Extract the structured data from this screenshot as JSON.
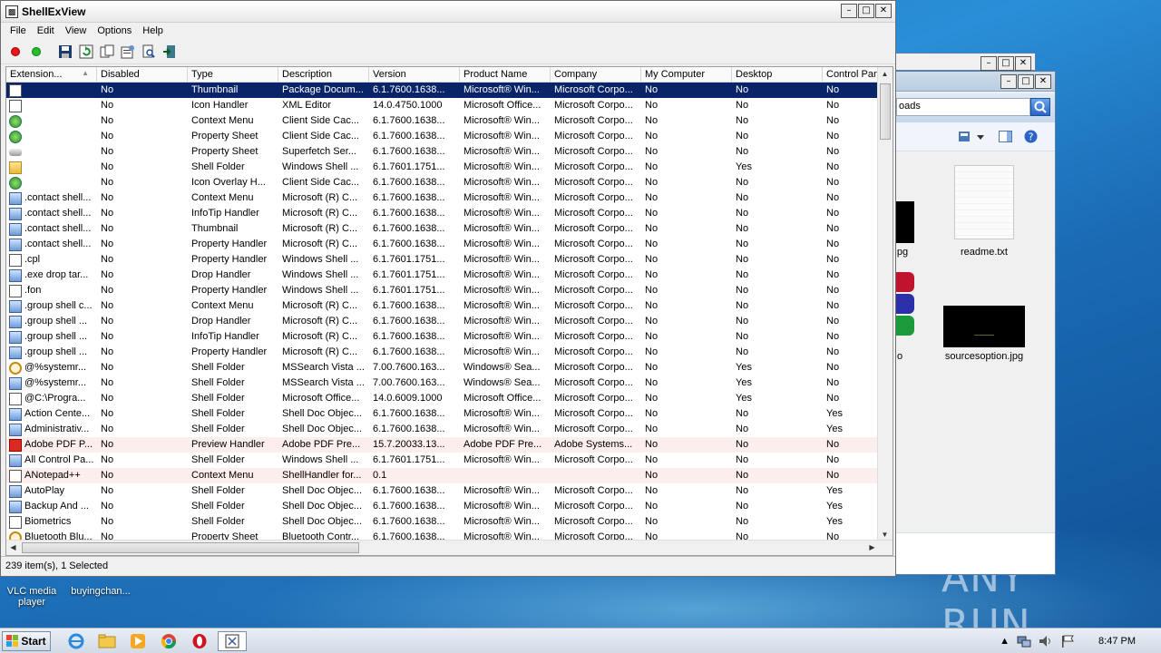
{
  "window": {
    "title": "ShellExView",
    "min": "–",
    "max": "□",
    "close": "✕"
  },
  "menu": [
    "File",
    "Edit",
    "View",
    "Options",
    "Help"
  ],
  "toolbar": [
    "red-dot-icon",
    "green-dot-icon",
    "save-icon",
    "refresh-icon",
    "copy-icon",
    "properties-icon",
    "find-icon",
    "exit-icon"
  ],
  "columns": [
    "Extension...",
    "Disabled",
    "Type",
    "Description",
    "Version",
    "Product Name",
    "Company",
    "My Computer",
    "Desktop",
    "Control Panel"
  ],
  "rows": [
    {
      "icon": "doc",
      "name": "",
      "disabled": "No",
      "type": "Thumbnail",
      "desc": "Package Docum...",
      "ver": "6.1.7600.1638...",
      "product": "Microsoft® Win...",
      "company": "Microsoft Corpo...",
      "mycomp": "No",
      "desktop": "No",
      "cp": "No",
      "selected": true
    },
    {
      "icon": "doc",
      "name": "",
      "disabled": "No",
      "type": "Icon Handler",
      "desc": "XML Editor",
      "ver": "14.0.4750.1000",
      "product": "Microsoft Office...",
      "company": "Microsoft Corpo...",
      "mycomp": "No",
      "desktop": "No",
      "cp": "No"
    },
    {
      "icon": "green",
      "name": "",
      "disabled": "No",
      "type": "Context Menu",
      "desc": "Client Side Cac...",
      "ver": "6.1.7600.1638...",
      "product": "Microsoft® Win...",
      "company": "Microsoft Corpo...",
      "mycomp": "No",
      "desktop": "No",
      "cp": "No"
    },
    {
      "icon": "green",
      "name": "",
      "disabled": "No",
      "type": "Property Sheet",
      "desc": "Client Side Cac...",
      "ver": "6.1.7600.1638...",
      "product": "Microsoft® Win...",
      "company": "Microsoft Corpo...",
      "mycomp": "No",
      "desktop": "No",
      "cp": "No"
    },
    {
      "icon": "drive",
      "name": "",
      "disabled": "No",
      "type": "Property Sheet",
      "desc": "Superfetch Ser...",
      "ver": "6.1.7600.1638...",
      "product": "Microsoft® Win...",
      "company": "Microsoft Corpo...",
      "mycomp": "No",
      "desktop": "No",
      "cp": "No"
    },
    {
      "icon": "folder",
      "name": "",
      "disabled": "No",
      "type": "Shell Folder",
      "desc": "Windows Shell ...",
      "ver": "6.1.7601.1751...",
      "product": "Microsoft® Win...",
      "company": "Microsoft Corpo...",
      "mycomp": "No",
      "desktop": "Yes",
      "cp": "No"
    },
    {
      "icon": "green",
      "name": "",
      "disabled": "No",
      "type": "Icon Overlay H...",
      "desc": "Client Side Cac...",
      "ver": "6.1.7600.1638...",
      "product": "Microsoft® Win...",
      "company": "Microsoft Corpo...",
      "mycomp": "No",
      "desktop": "No",
      "cp": "No"
    },
    {
      "icon": "blue",
      "name": ".contact shell...",
      "disabled": "No",
      "type": "Context Menu",
      "desc": "Microsoft (R) C...",
      "ver": "6.1.7600.1638...",
      "product": "Microsoft® Win...",
      "company": "Microsoft Corpo...",
      "mycomp": "No",
      "desktop": "No",
      "cp": "No"
    },
    {
      "icon": "blue",
      "name": ".contact shell...",
      "disabled": "No",
      "type": "InfoTip Handler",
      "desc": "Microsoft (R) C...",
      "ver": "6.1.7600.1638...",
      "product": "Microsoft® Win...",
      "company": "Microsoft Corpo...",
      "mycomp": "No",
      "desktop": "No",
      "cp": "No"
    },
    {
      "icon": "blue",
      "name": ".contact shell...",
      "disabled": "No",
      "type": "Thumbnail",
      "desc": "Microsoft (R) C...",
      "ver": "6.1.7600.1638...",
      "product": "Microsoft® Win...",
      "company": "Microsoft Corpo...",
      "mycomp": "No",
      "desktop": "No",
      "cp": "No"
    },
    {
      "icon": "blue",
      "name": ".contact shell...",
      "disabled": "No",
      "type": "Property Handler",
      "desc": "Microsoft (R) C...",
      "ver": "6.1.7600.1638...",
      "product": "Microsoft® Win...",
      "company": "Microsoft Corpo...",
      "mycomp": "No",
      "desktop": "No",
      "cp": "No"
    },
    {
      "icon": "doc",
      "name": ".cpl",
      "disabled": "No",
      "type": "Property Handler",
      "desc": "Windows Shell ...",
      "ver": "6.1.7601.1751...",
      "product": "Microsoft® Win...",
      "company": "Microsoft Corpo...",
      "mycomp": "No",
      "desktop": "No",
      "cp": "No"
    },
    {
      "icon": "blue",
      "name": ".exe drop tar...",
      "disabled": "No",
      "type": "Drop Handler",
      "desc": "Windows Shell ...",
      "ver": "6.1.7601.1751...",
      "product": "Microsoft® Win...",
      "company": "Microsoft Corpo...",
      "mycomp": "No",
      "desktop": "No",
      "cp": "No"
    },
    {
      "icon": "doc",
      "name": ".fon",
      "disabled": "No",
      "type": "Property Handler",
      "desc": "Windows Shell ...",
      "ver": "6.1.7601.1751...",
      "product": "Microsoft® Win...",
      "company": "Microsoft Corpo...",
      "mycomp": "No",
      "desktop": "No",
      "cp": "No"
    },
    {
      "icon": "blue",
      "name": ".group shell c...",
      "disabled": "No",
      "type": "Context Menu",
      "desc": "Microsoft (R) C...",
      "ver": "6.1.7600.1638...",
      "product": "Microsoft® Win...",
      "company": "Microsoft Corpo...",
      "mycomp": "No",
      "desktop": "No",
      "cp": "No"
    },
    {
      "icon": "blue",
      "name": ".group shell ...",
      "disabled": "No",
      "type": "Drop Handler",
      "desc": "Microsoft (R) C...",
      "ver": "6.1.7600.1638...",
      "product": "Microsoft® Win...",
      "company": "Microsoft Corpo...",
      "mycomp": "No",
      "desktop": "No",
      "cp": "No"
    },
    {
      "icon": "blue",
      "name": ".group shell ...",
      "disabled": "No",
      "type": "InfoTip Handler",
      "desc": "Microsoft (R) C...",
      "ver": "6.1.7600.1638...",
      "product": "Microsoft® Win...",
      "company": "Microsoft Corpo...",
      "mycomp": "No",
      "desktop": "No",
      "cp": "No"
    },
    {
      "icon": "blue",
      "name": ".group shell ...",
      "disabled": "No",
      "type": "Property Handler",
      "desc": "Microsoft (R) C...",
      "ver": "6.1.7600.1638...",
      "product": "Microsoft® Win...",
      "company": "Microsoft Corpo...",
      "mycomp": "No",
      "desktop": "No",
      "cp": "No"
    },
    {
      "icon": "gear",
      "name": "@%systemr...",
      "disabled": "No",
      "type": "Shell Folder",
      "desc": "MSSearch Vista ...",
      "ver": "7.00.7600.163...",
      "product": "Windows® Sea...",
      "company": "Microsoft Corpo...",
      "mycomp": "No",
      "desktop": "Yes",
      "cp": "No"
    },
    {
      "icon": "blue",
      "name": "@%systemr...",
      "disabled": "No",
      "type": "Shell Folder",
      "desc": "MSSearch Vista ...",
      "ver": "7.00.7600.163...",
      "product": "Windows® Sea...",
      "company": "Microsoft Corpo...",
      "mycomp": "No",
      "desktop": "Yes",
      "cp": "No"
    },
    {
      "icon": "doc",
      "name": "@C:\\Progra...",
      "disabled": "No",
      "type": "Shell Folder",
      "desc": "Microsoft Office...",
      "ver": "14.0.6009.1000",
      "product": "Microsoft Office...",
      "company": "Microsoft Corpo...",
      "mycomp": "No",
      "desktop": "Yes",
      "cp": "No"
    },
    {
      "icon": "blue",
      "name": "Action Cente...",
      "disabled": "No",
      "type": "Shell Folder",
      "desc": "Shell Doc Objec...",
      "ver": "6.1.7600.1638...",
      "product": "Microsoft® Win...",
      "company": "Microsoft Corpo...",
      "mycomp": "No",
      "desktop": "No",
      "cp": "Yes"
    },
    {
      "icon": "blue",
      "name": "Administrativ...",
      "disabled": "No",
      "type": "Shell Folder",
      "desc": "Shell Doc Objec...",
      "ver": "6.1.7600.1638...",
      "product": "Microsoft® Win...",
      "company": "Microsoft Corpo...",
      "mycomp": "No",
      "desktop": "No",
      "cp": "Yes"
    },
    {
      "icon": "red",
      "name": "Adobe PDF P...",
      "disabled": "No",
      "type": "Preview Handler",
      "desc": "Adobe PDF Pre...",
      "ver": "15.7.20033.13...",
      "product": "Adobe PDF Pre...",
      "company": "Adobe Systems...",
      "mycomp": "No",
      "desktop": "No",
      "cp": "No",
      "pink": true
    },
    {
      "icon": "blue",
      "name": "All Control Pa...",
      "disabled": "No",
      "type": "Shell Folder",
      "desc": "Windows Shell ...",
      "ver": "6.1.7601.1751...",
      "product": "Microsoft® Win...",
      "company": "Microsoft Corpo...",
      "mycomp": "No",
      "desktop": "No",
      "cp": "No"
    },
    {
      "icon": "doc",
      "name": "ANotepad++",
      "disabled": "No",
      "type": "Context Menu",
      "desc": "ShellHandler for...",
      "ver": "0.1",
      "product": "",
      "company": "",
      "mycomp": "No",
      "desktop": "No",
      "cp": "No",
      "pink": true
    },
    {
      "icon": "blue",
      "name": "AutoPlay",
      "disabled": "No",
      "type": "Shell Folder",
      "desc": "Shell Doc Objec...",
      "ver": "6.1.7600.1638...",
      "product": "Microsoft® Win...",
      "company": "Microsoft Corpo...",
      "mycomp": "No",
      "desktop": "No",
      "cp": "Yes"
    },
    {
      "icon": "blue",
      "name": "Backup And ...",
      "disabled": "No",
      "type": "Shell Folder",
      "desc": "Shell Doc Objec...",
      "ver": "6.1.7600.1638...",
      "product": "Microsoft® Win...",
      "company": "Microsoft Corpo...",
      "mycomp": "No",
      "desktop": "No",
      "cp": "Yes"
    },
    {
      "icon": "doc",
      "name": "Biometrics",
      "disabled": "No",
      "type": "Shell Folder",
      "desc": "Shell Doc Objec...",
      "ver": "6.1.7600.1638...",
      "product": "Microsoft® Win...",
      "company": "Microsoft Corpo...",
      "mycomp": "No",
      "desktop": "No",
      "cp": "Yes"
    },
    {
      "icon": "gear",
      "name": "Bluetooth Blu...",
      "disabled": "No",
      "type": "Property Sheet",
      "desc": "Bluetooth Contr...",
      "ver": "6.1.7600.1638...",
      "product": "Microsoft® Win...",
      "company": "Microsoft Corpo...",
      "mycomp": "No",
      "desktop": "No",
      "cp": "No"
    }
  ],
  "status": "239 item(s), 1 Selected",
  "explorer": {
    "address": "oads",
    "files": [
      {
        "label": "readme.txt"
      },
      {
        "label": "sourcesoption.jpg"
      },
      {
        "label": "pg"
      },
      {
        "label": "o"
      }
    ]
  },
  "desktop": {
    "icons": [
      {
        "label": "VLC media player"
      },
      {
        "label": "buyingchan..."
      }
    ],
    "watermark": "ANY RUN"
  },
  "taskbar": {
    "start": "Start",
    "clock": "8:47 PM"
  },
  "colors": {
    "selection": "#0a246a",
    "highlight_row": "#fdeeee"
  }
}
